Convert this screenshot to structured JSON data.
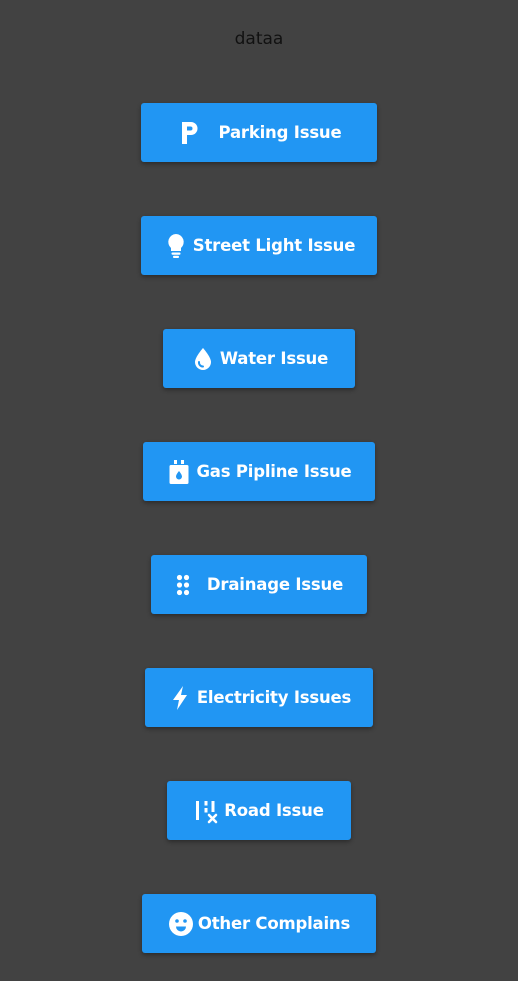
{
  "header": {
    "title": "dataa"
  },
  "buttons": [
    {
      "label": "Parking Issue",
      "icon": "parking-icon"
    },
    {
      "label": "Street Light Issue",
      "icon": "lightbulb-icon"
    },
    {
      "label": "Water Issue",
      "icon": "water-drop-icon"
    },
    {
      "label": "Gas Pipline Issue",
      "icon": "gas-canister-icon"
    },
    {
      "label": "Drainage Issue",
      "icon": "drainage-dots-icon"
    },
    {
      "label": "Electricity Issues",
      "icon": "lightning-bolt-icon"
    },
    {
      "label": "Road Issue",
      "icon": "road-blocked-icon"
    },
    {
      "label": "Other Complains",
      "icon": "smiley-face-icon"
    }
  ],
  "colors": {
    "background": "#424242",
    "button": "#2196F3",
    "button_text": "#FFFFFF",
    "title_text": "#111111"
  }
}
